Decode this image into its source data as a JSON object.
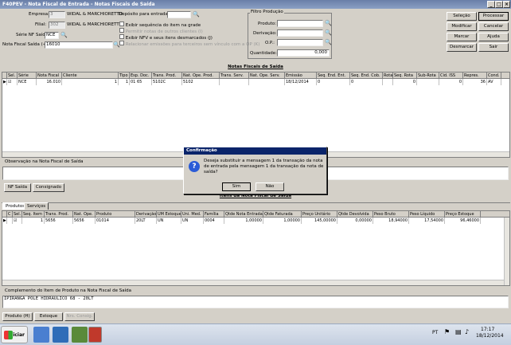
{
  "window": {
    "title": "F40PEV - Nota Fiscal de Entrada - Notas Fiscais de Saída"
  },
  "form": {
    "empresa_label": "Empresa:",
    "empresa_code": "3",
    "empresa_name": "WIDAL & MARCHIORETTO",
    "filial_label": "Filial:",
    "filial_code": "302",
    "filial_name": "WIDAL & MARCHIORETTO",
    "serie_label": "Série NF Saída:",
    "serie_value": "NCE",
    "nf_label": "Nota Fiscal Saída (+):",
    "nf_value": "16010",
    "deposito_label": "Depósito para entrada:",
    "deposito_value": ""
  },
  "options": [
    {
      "label": "Exibir sequência do item na grade",
      "checked": false,
      "enabled": true
    },
    {
      "label": "Permitir notas de outros clientes (I)",
      "checked": false,
      "enabled": false
    },
    {
      "label": "Exibir NFV e seus itens desmarcados (J)",
      "checked": false,
      "enabled": true
    },
    {
      "label": "Relacionar emissões para terceiros sem vínculo com a OP (K)",
      "checked": false,
      "enabled": false
    }
  ],
  "filtro": {
    "title": "Filtro Produção",
    "produto_label": "Produto:",
    "derivacao_label": "Derivação:",
    "op_label": "O.P.:",
    "quantidade_label": "Quantidade:",
    "quantidade_value": "0,000"
  },
  "actions": {
    "selecao": "Seleção",
    "processar": "Processar",
    "modificar": "Modificar",
    "cancelar": "Cancelar",
    "marcar": "Marcar",
    "ajuda": "Ajuda",
    "desmarcar": "Desmarcar",
    "sair": "Sair"
  },
  "nf_section": {
    "title": "Notas Fiscais de Saída",
    "headers": [
      "Sel.",
      "Série",
      "Nota Fiscal",
      "Cliente",
      "Tipo",
      "Esp. Doc.",
      "Trans. Prod.",
      "Nat. Ope. Prod.",
      "Trans. Serv.",
      "Nat. Ope. Serv.",
      "Emissão",
      "Seq. End. Ent.",
      "Seq. End. Cob.",
      "Rota",
      "Seq. Rota",
      "Sub-Rota",
      "Cid. ISS",
      "Repres.",
      "Cond. Pg"
    ],
    "rows": [
      [
        "☑",
        "NCE",
        "16.010",
        "1",
        "1",
        "01 65",
        "5102C",
        "5102",
        "",
        "",
        "18/12/2014",
        "0",
        "0",
        "",
        "0",
        "",
        "0",
        "36",
        "AV"
      ]
    ]
  },
  "obs": {
    "label": "Observação na Nota Fiscal de Saída",
    "value": "",
    "btn_nf": "NF Saída",
    "btn_consignado": "Consignado"
  },
  "items_section": {
    "title": "Itens da Nota Fiscal de Saída",
    "tabs": [
      "Produtos",
      "Serviços"
    ],
    "headers": [
      "C",
      "Sel.",
      "Seq. Item",
      "Trans. Prod.",
      "Nat. Ope.",
      "Produto",
      "Derivação",
      "UM Estoque",
      "Uni. Med.",
      "Família",
      "Qtde Nota Entrada",
      "Qtde Faturada",
      "Preço Unitário",
      "Qtde Devolvida",
      "Peso Bruto",
      "Peso Líquido",
      "Preço Estoque"
    ],
    "rows": [
      [
        "",
        "☑",
        "1",
        "5656",
        "5656",
        "01014",
        "20LT",
        "UN",
        "UN",
        "0004",
        "1,00000",
        "1,00000",
        "145,00000",
        "0,00000",
        "18,94000",
        "17,54000",
        "96,46000"
      ]
    ]
  },
  "complemento": {
    "label": "Complemento do Item de Produto na Nota Fiscal de Saída",
    "value": "IPIRANGA POLE HIDRAULICO 68 - 20LT"
  },
  "bottom_buttons": {
    "produto": "Produto (H)",
    "estoque": "Estoque",
    "nrs_consig": "Nrs. Consig."
  },
  "dialog": {
    "title": "Confirmação",
    "message": "Deseja substituir a mensagem 1 da transação da nota de entrada pela mensagem 1 da transação da nota de saída?",
    "yes": "Sim",
    "no": "Não"
  },
  "taskbar": {
    "start_label": "Iniciar",
    "lang": "PT",
    "time": "17:17",
    "date": "18/12/2014"
  },
  "colors": {
    "title_bar": "#0a246a",
    "window_bg": "#d4d0c8",
    "grid_bg": "#ffffff"
  }
}
